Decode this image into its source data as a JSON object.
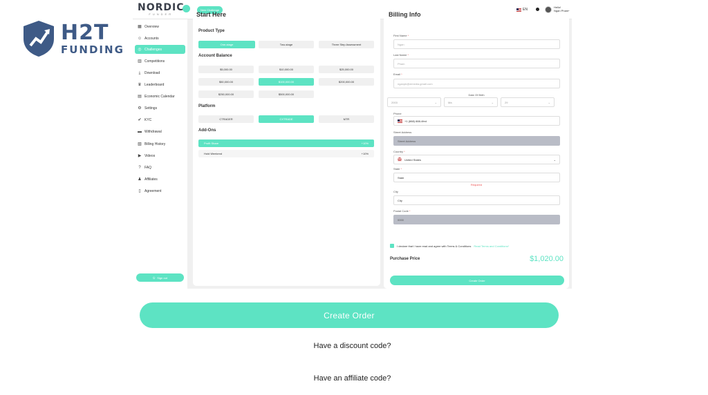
{
  "watermark": {
    "line1": "H2T",
    "line2": "FUNDING"
  },
  "topbar": {
    "logo": "NORDIC",
    "logo_sub": "FUNDER",
    "new_challenge": "New Challenge",
    "lang": "EN",
    "user_greeting": "Hello!",
    "user_name": "Ngan Pham"
  },
  "sidebar": {
    "items": [
      {
        "label": "Overview",
        "icon": "grid-icon"
      },
      {
        "label": "Accounts",
        "icon": "user-icon"
      },
      {
        "label": "Challenges",
        "icon": "target-icon",
        "active": true
      },
      {
        "label": "Competitions",
        "icon": "bar-chart-icon"
      },
      {
        "label": "Download",
        "icon": "download-icon"
      },
      {
        "label": "Leaderboard",
        "icon": "trophy-icon"
      },
      {
        "label": "Economic Calendar",
        "icon": "calendar-icon"
      },
      {
        "label": "Settings",
        "icon": "gear-icon"
      },
      {
        "label": "KYC",
        "icon": "user-check-icon"
      },
      {
        "label": "Withdrawal",
        "icon": "card-icon"
      },
      {
        "label": "Billing History",
        "icon": "receipt-icon"
      },
      {
        "label": "Videos",
        "icon": "video-icon"
      },
      {
        "label": "FAQ",
        "icon": "question-icon"
      },
      {
        "label": "Affiliates",
        "icon": "people-icon"
      },
      {
        "label": "Agreement",
        "icon": "document-icon"
      }
    ],
    "signout": "Sign out"
  },
  "start": {
    "title": "Start Here",
    "product_type_label": "Product Type",
    "product_types": [
      "One-stage",
      "Two-stage",
      "Three Step Assessment"
    ],
    "selected_product": 0,
    "balance_label": "Account Balance",
    "balances": [
      "$5,000.00",
      "$10,000.00",
      "$25,000.00",
      "$50,000.00",
      "$100,000.00",
      "$200,000.00",
      "$250,000.00",
      "$500,000.00"
    ],
    "selected_balance": 4,
    "platform_label": "Platform",
    "platforms": [
      "CTRADER",
      "CXTRADE",
      "MTR"
    ],
    "selected_platform": 1,
    "addons_label": "Add-Ons",
    "addons": [
      {
        "name": "Profit Share",
        "value": "+10%",
        "selected": true
      },
      {
        "name": "Hold Weekend",
        "value": "+10%",
        "selected": false
      }
    ]
  },
  "billing": {
    "title": "Billing Info",
    "first_name_label": "First Name",
    "first_name": "Ngan",
    "last_name_label": "Last Name",
    "last_name": "Pham",
    "email_label": "Email",
    "email": "nganpb@zimedia.gmail.com",
    "dob_label": "Date Of Birth",
    "dob_year": "2003",
    "dob_month": "Ma",
    "dob_day": "29",
    "phone_label": "Phone",
    "phone": "+1 (888) 888-4fed",
    "street_label": "Street Address",
    "street_placeholder": "Street Address",
    "country_label": "Country",
    "country": "United States",
    "state_label": "State",
    "state": "State",
    "required_msg": "Required",
    "city_label": "City",
    "city": "City",
    "postal_label": "Postal Code",
    "postal": "0000",
    "declare_text": "I declare that I have read and agree with Terms & Conditions",
    "declare_link": "Read Terms and Conditions*",
    "purchase_label": "Purchase Price",
    "purchase_value": "$1,020.00",
    "create_order": "Create Order"
  },
  "bottom": {
    "create_order": "Create Order",
    "discount": "Have a discount code?",
    "affiliate": "Have an affiliate code?"
  },
  "colors": {
    "accent": "#5de3c3",
    "brand_dark": "#3e5a86"
  }
}
